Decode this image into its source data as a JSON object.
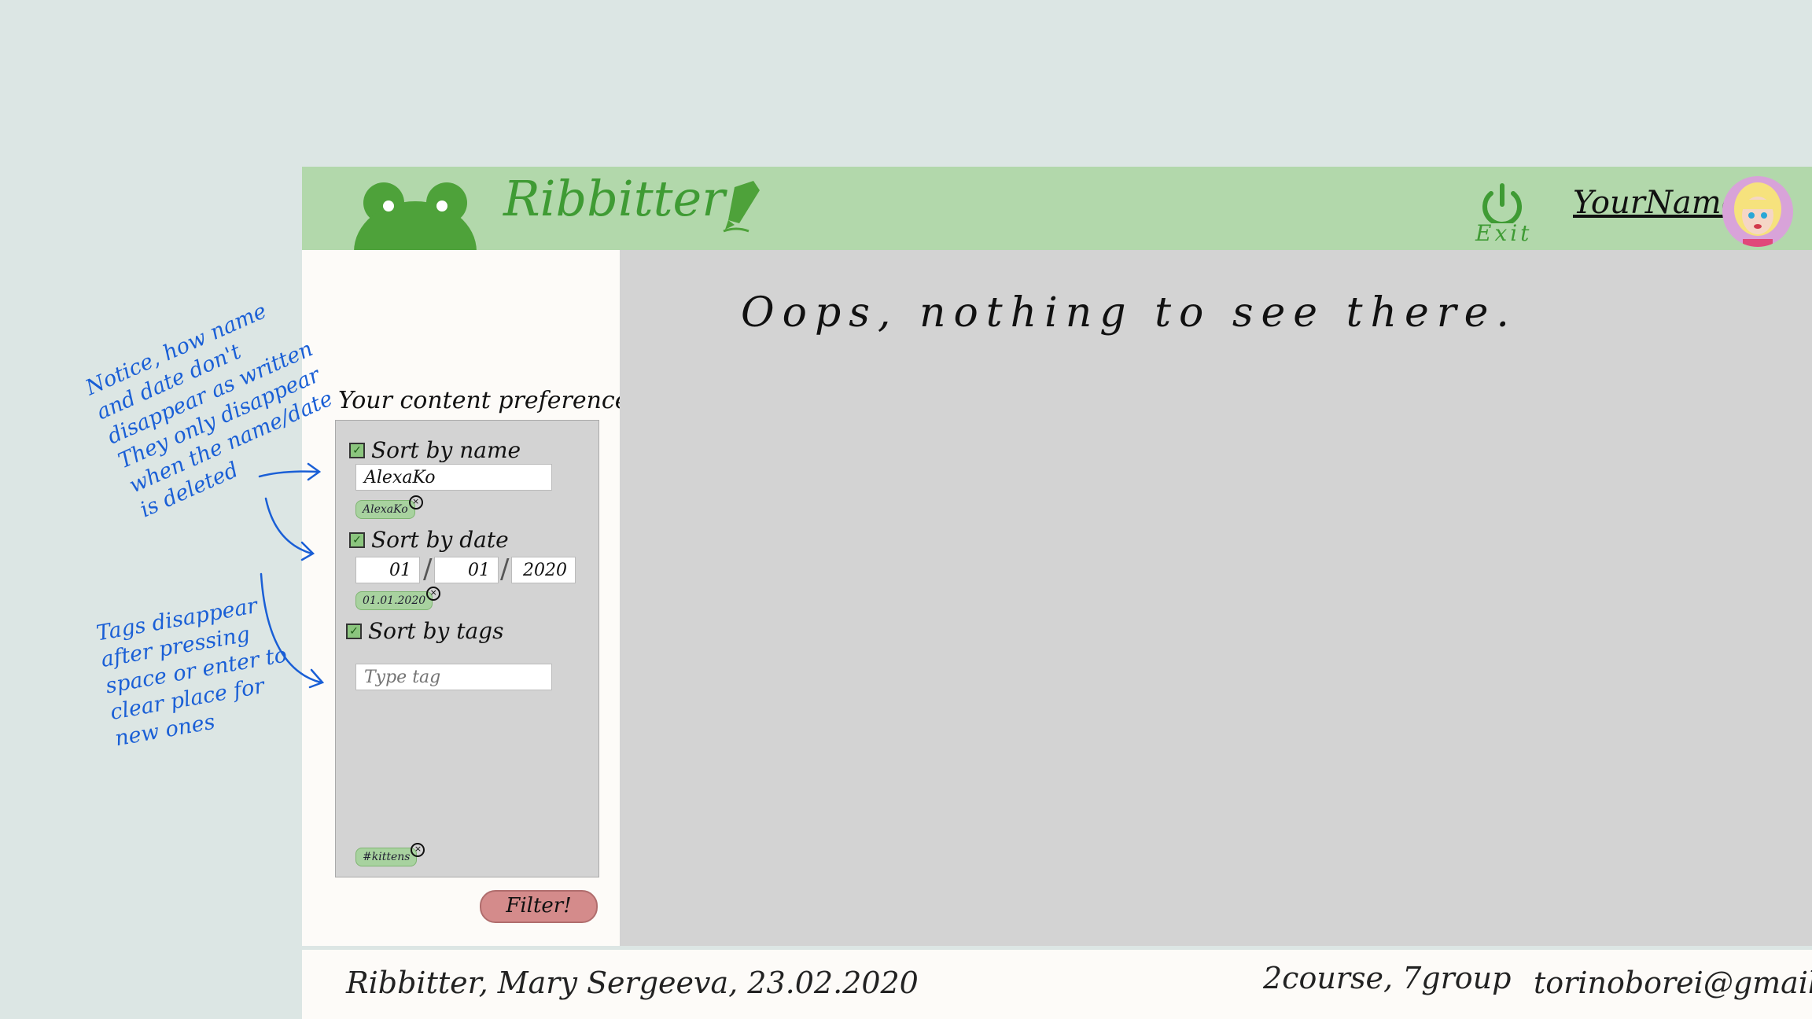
{
  "header": {
    "app_name": "Ribbitter",
    "exit_label": "Exit",
    "username": "YourName",
    "icons": [
      "frog-logo-icon",
      "pencil-icon",
      "power-icon",
      "avatar"
    ],
    "colors": {
      "header_bg": "#b2d8ab",
      "brand_green": "#3f9b34"
    }
  },
  "main": {
    "empty_message": "Oops, nothing to see there."
  },
  "sidebar": {
    "prefs_title": "Your content preferences:",
    "sort_by_name": {
      "label": "Sort by name",
      "checked": true,
      "value": "AlexaKo",
      "chip": "AlexaKo"
    },
    "sort_by_date": {
      "label": "Sort by date",
      "checked": true,
      "day": "01",
      "month": "01",
      "year": "2020",
      "chip": "01.01.2020"
    },
    "sort_by_tags": {
      "label": "Sort by tags",
      "checked": true,
      "placeholder": "Type tag",
      "chip": "#kittens"
    },
    "filter_button": "Filter!"
  },
  "annotations": {
    "note1": "Notice, how name and date don't disappear as written They only disappear when the name/date is deleted",
    "note2": "Tags disappear after pressing space or enter to clear place for new ones"
  },
  "footer": {
    "left": "Ribbitter, Mary Sergeeva, 23.02.2020",
    "middle": "2course, 7group",
    "right": "torinoborei@gmail.com"
  }
}
